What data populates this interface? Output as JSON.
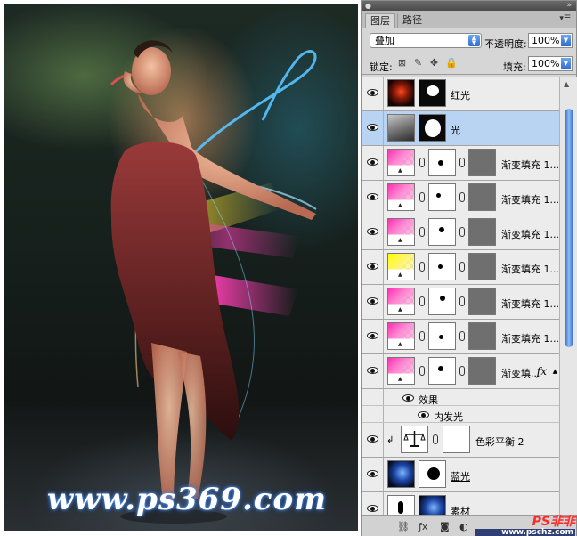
{
  "watermark": "www.ps369.com",
  "panel": {
    "tabs": [
      "图层",
      "路径"
    ],
    "blend_mode": "叠加",
    "opacity_label": "不透明度:",
    "opacity_value": "100%",
    "lock_label": "锁定:",
    "fill_label": "填充:",
    "fill_value": "100%"
  },
  "layers": [
    {
      "name": "红光",
      "type": "image",
      "thumb": "red-glow",
      "mask": "dark"
    },
    {
      "name": "光",
      "type": "image",
      "thumb": "photo",
      "mask": "dark",
      "selected": true
    },
    {
      "name": "渐变填充 1...",
      "type": "gradient-fill",
      "color": "pink"
    },
    {
      "name": "渐变填充 1...",
      "type": "gradient-fill",
      "color": "pink"
    },
    {
      "name": "渐变填充 1...",
      "type": "gradient-fill",
      "color": "pink"
    },
    {
      "name": "渐变填充 1...",
      "type": "gradient-fill",
      "color": "yellow"
    },
    {
      "name": "渐变填充 1...",
      "type": "gradient-fill",
      "color": "pink"
    },
    {
      "name": "渐变填充 1...",
      "type": "gradient-fill",
      "color": "pink"
    },
    {
      "name": "渐变填...",
      "type": "gradient-fill",
      "color": "pink",
      "fx": "fx"
    }
  ],
  "effects": {
    "label": "效果",
    "items": [
      "内发光"
    ]
  },
  "color_balance": {
    "name": "色彩平衡 2"
  },
  "bottom_layers": [
    {
      "name": "蓝光"
    },
    {
      "name": "素材"
    }
  ],
  "credit": {
    "main": "PS非非",
    "sub": "www.pschz.com"
  }
}
